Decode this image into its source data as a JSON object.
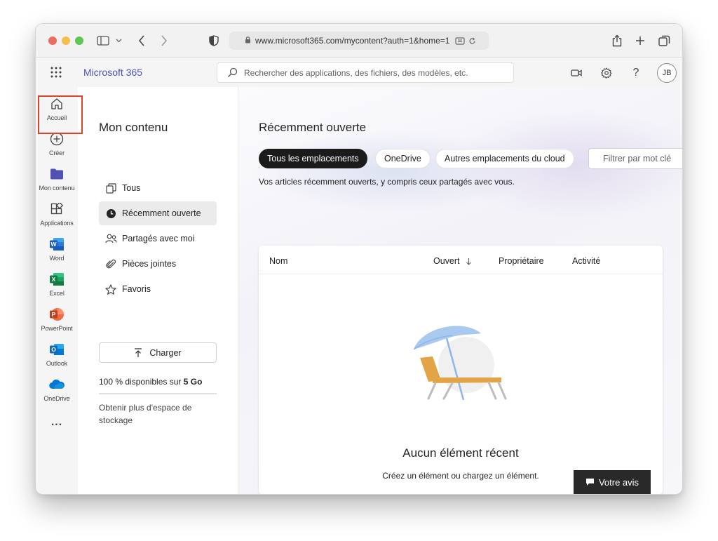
{
  "browser": {
    "url": "www.microsoft365.com/mycontent?auth=1&home=1",
    "traffic_light_colors": [
      "#ec6a5e",
      "#f4bf4f",
      "#61c554"
    ]
  },
  "header": {
    "brand": "Microsoft 365",
    "brand_color": "#4b53bc",
    "search_placeholder": "Rechercher des applications, des fichiers, des modèles, etc.",
    "avatar_initials": "JB"
  },
  "rail": {
    "items": [
      {
        "label": "Accueil",
        "icon": "home-icon"
      },
      {
        "label": "Créer",
        "icon": "plus-circle-icon"
      },
      {
        "label": "Mon contenu",
        "icon": "folder-icon"
      },
      {
        "label": "Applications",
        "icon": "apps-icon"
      },
      {
        "label": "Word",
        "icon": "word-icon",
        "color": "#185abd"
      },
      {
        "label": "Excel",
        "icon": "excel-icon",
        "color": "#107c41"
      },
      {
        "label": "PowerPoint",
        "icon": "powerpoint-icon",
        "color": "#c43e1c"
      },
      {
        "label": "Outlook",
        "icon": "outlook-icon",
        "color": "#0f6cbd"
      },
      {
        "label": "OneDrive",
        "icon": "onedrive-icon",
        "color": "#0078d4"
      }
    ],
    "more": "..."
  },
  "leftnav": {
    "title": "Mon contenu",
    "items": [
      {
        "label": "Tous",
        "icon": "all-files-icon"
      },
      {
        "label": "Récemment ouverte",
        "icon": "clock-icon"
      },
      {
        "label": "Partagés avec moi",
        "icon": "people-icon"
      },
      {
        "label": "Pièces jointes",
        "icon": "paperclip-icon"
      },
      {
        "label": "Favoris",
        "icon": "star-icon"
      }
    ],
    "upload_label": "Charger",
    "storage_prefix": "100 % disponibles sur ",
    "storage_total": "5 Go",
    "storage_used_fraction": 0.0,
    "more_storage": "Obtenir plus d'espace de stockage"
  },
  "main": {
    "title": "Récemment ouverte",
    "filters": [
      "Tous les emplacements",
      "OneDrive",
      "Autres emplacements du cloud"
    ],
    "filter_placeholder": "Filtrer par mot clé",
    "subtitle": "Vos articles récemment ouverts, y compris ceux partagés avec vous.",
    "columns": [
      "Nom",
      "Ouvert",
      "Propriétaire",
      "Activité"
    ],
    "empty_title": "Aucun élément récent",
    "empty_subtitle": "Créez un élément ou chargez un élément."
  },
  "feedback_label": "Votre avis"
}
